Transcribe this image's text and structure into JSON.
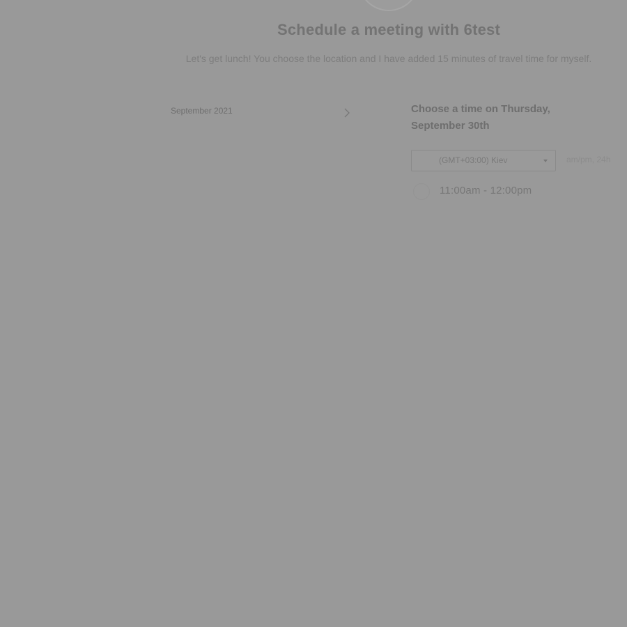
{
  "header": {
    "title": "Schedule a meeting with 6test",
    "subtitle": "Let's get lunch! You choose the location and I have added 15 minutes of travel time for myself."
  },
  "calendar": {
    "month_label": "September 2021",
    "next_icon": "chevron-right-icon"
  },
  "time_panel": {
    "heading": "Choose a time on Thursday, September 30th",
    "timezone": {
      "selected": "(GMT+03:00) Kiev",
      "format_toggle": "am/pm, 24h"
    },
    "slots": [
      {
        "label": "11:00am - 12:00pm"
      }
    ]
  },
  "colors": {
    "overlay_background": "#999999",
    "heading_text": "#737373"
  }
}
